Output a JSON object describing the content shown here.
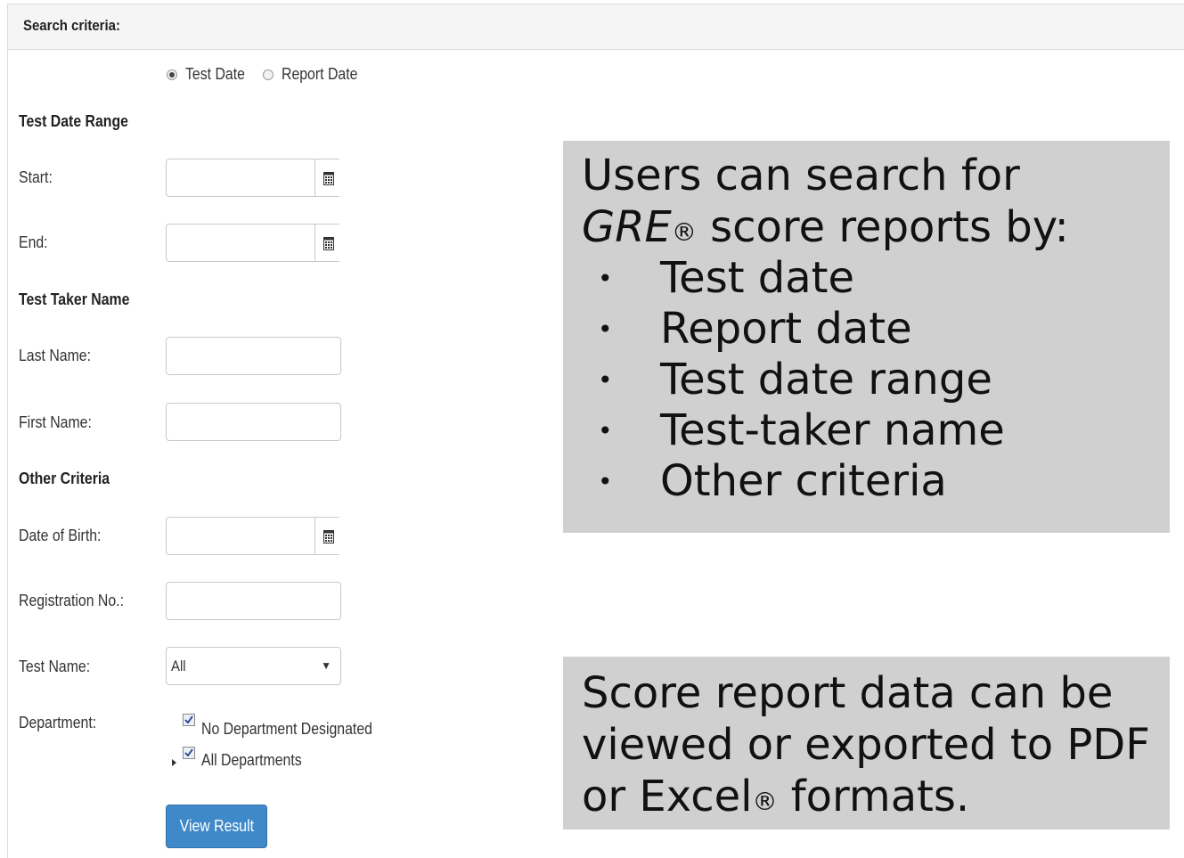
{
  "panel": {
    "title": "Search criteria:"
  },
  "date_type": {
    "options": [
      {
        "label": "Test Date",
        "selected": true
      },
      {
        "label": "Report Date",
        "selected": false
      }
    ]
  },
  "test_date_range": {
    "heading": "Test Date Range",
    "start_label": "Start:",
    "start_value": "",
    "end_label": "End:",
    "end_value": "",
    "icon": "calendar-icon"
  },
  "test_taker": {
    "heading": "Test Taker Name",
    "last_name_label": "Last Name:",
    "last_name_value": "",
    "first_name_label": "First Name:",
    "first_name_value": ""
  },
  "other": {
    "heading": "Other Criteria",
    "dob_label": "Date of Birth:",
    "dob_value": "",
    "registration_label": "Registration No.:",
    "registration_value": "",
    "test_name_label": "Test Name:",
    "test_name_value": "All",
    "department_label": "Department:",
    "departments": [
      {
        "label": "No Department Designated",
        "checked": true
      },
      {
        "label": "All Departments",
        "checked": true,
        "expandable": true
      }
    ]
  },
  "actions": {
    "view_result": "View Result"
  },
  "callout_search": {
    "line1": "Users can search for",
    "line2_brand": "GRE",
    "line2_reg": "®",
    "line2_rest": " score reports by:",
    "items": [
      "Test date",
      "Report date",
      "Test date range",
      "Test-taker name",
      "Other criteria"
    ]
  },
  "callout_export": {
    "line1": "Score report data can be",
    "line2": "viewed or exported to PDF",
    "line3_pre": "or Excel",
    "line3_reg": "®",
    "line3_post": " formats."
  },
  "colors": {
    "primary_button": "#3f89c8",
    "callout_bg": "#d0d0d0",
    "panel_header_bg": "#f5f5f5"
  }
}
